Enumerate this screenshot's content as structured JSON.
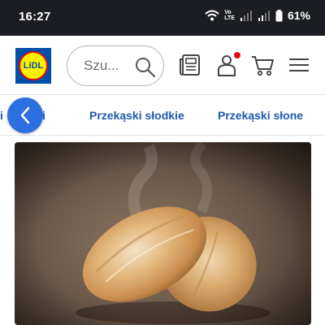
{
  "status_bar": {
    "time": "16:27",
    "volte_top": "Vo",
    "volte_bottom": "LTE",
    "battery": "61%"
  },
  "header": {
    "logo_text": "LiDL",
    "search": {
      "placeholder": "Szu..."
    },
    "icons": [
      "leaflet-icon",
      "account-icon",
      "cart-icon",
      "menu-icon"
    ]
  },
  "categories": {
    "partial_left": "i",
    "partial_mid": "i",
    "items": [
      "Przekąski słodkie",
      "Przekąski słone"
    ]
  },
  "colors": {
    "brand_blue": "#0050aa",
    "brand_yellow": "#fff000",
    "brand_red": "#e60a14",
    "link_blue": "#1f5aa8",
    "back_button": "#2b6fe0"
  }
}
